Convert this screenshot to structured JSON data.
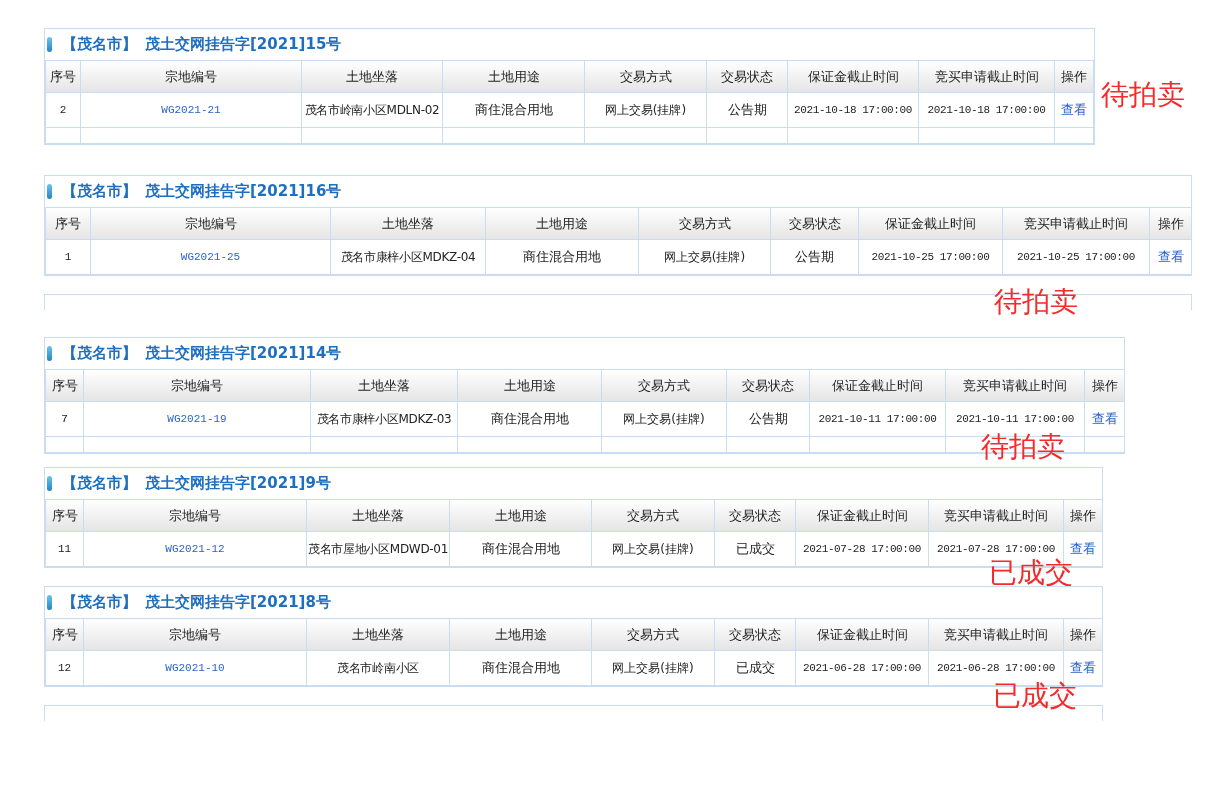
{
  "panels": [
    {
      "city": "【茂名市】",
      "title": "茂土交网挂告字[2021]15号",
      "columns": [
        "序号",
        "宗地编号",
        "土地坐落",
        "土地用途",
        "交易方式",
        "交易状态",
        "保证金截止时间",
        "竞买申请截止时间",
        "操作"
      ],
      "rows": [
        {
          "no": "2",
          "code": "WG2021-21",
          "location": "茂名市岭南小区MDLN-02",
          "use": "商住混合用地",
          "method": "网上交易(挂牌)",
          "status": "公告期",
          "deposit_deadline": "2021-10-18 17:00:00",
          "apply_deadline": "2021-10-18 17:00:00",
          "action": "查看"
        }
      ],
      "note": "待拍卖"
    },
    {
      "city": "【茂名市】",
      "title": "茂土交网挂告字[2021]16号",
      "columns": [
        "序号",
        "宗地编号",
        "土地坐落",
        "土地用途",
        "交易方式",
        "交易状态",
        "保证金截止时间",
        "竞买申请截止时间",
        "操作"
      ],
      "rows": [
        {
          "no": "1",
          "code": "WG2021-25",
          "location": "茂名市康梓小区MDKZ-04",
          "use": "商住混合用地",
          "method": "网上交易(挂牌)",
          "status": "公告期",
          "deposit_deadline": "2021-10-25 17:00:00",
          "apply_deadline": "2021-10-25 17:00:00",
          "action": "查看"
        }
      ],
      "note": "待拍卖"
    },
    {
      "city": "【茂名市】",
      "title": "茂土交网挂告字[2021]14号",
      "columns": [
        "序号",
        "宗地编号",
        "土地坐落",
        "土地用途",
        "交易方式",
        "交易状态",
        "保证金截止时间",
        "竞买申请截止时间",
        "操作"
      ],
      "rows": [
        {
          "no": "7",
          "code": "WG2021-19",
          "location": "茂名市康梓小区MDKZ-03",
          "use": "商住混合用地",
          "method": "网上交易(挂牌)",
          "status": "公告期",
          "deposit_deadline": "2021-10-11 17:00:00",
          "apply_deadline": "2021-10-11 17:00:00",
          "action": "查看"
        }
      ],
      "note": "待拍卖"
    },
    {
      "city": "【茂名市】",
      "title": "茂土交网挂告字[2021]9号",
      "columns": [
        "序号",
        "宗地编号",
        "土地坐落",
        "土地用途",
        "交易方式",
        "交易状态",
        "保证金截止时间",
        "竞买申请截止时间",
        "操作"
      ],
      "rows": [
        {
          "no": "11",
          "code": "WG2021-12",
          "location": "茂名市屋地小区MDWD-01",
          "use": "商住混合用地",
          "method": "网上交易(挂牌)",
          "status": "已成交",
          "deposit_deadline": "2021-07-28 17:00:00",
          "apply_deadline": "2021-07-28 17:00:00",
          "action": "查看"
        }
      ],
      "note": "已成交"
    },
    {
      "city": "【茂名市】",
      "title": "茂土交网挂告字[2021]8号",
      "columns": [
        "序号",
        "宗地编号",
        "土地坐落",
        "土地用途",
        "交易方式",
        "交易状态",
        "保证金截止时间",
        "竞买申请截止时间",
        "操作"
      ],
      "rows": [
        {
          "no": "12",
          "code": "WG2021-10",
          "location": "茂名市岭南小区",
          "use": "商住混合用地",
          "method": "网上交易(挂牌)",
          "status": "已成交",
          "deposit_deadline": "2021-06-28 17:00:00",
          "apply_deadline": "2021-06-28 17:00:00",
          "action": "查看"
        }
      ],
      "note": "已成交"
    }
  ]
}
